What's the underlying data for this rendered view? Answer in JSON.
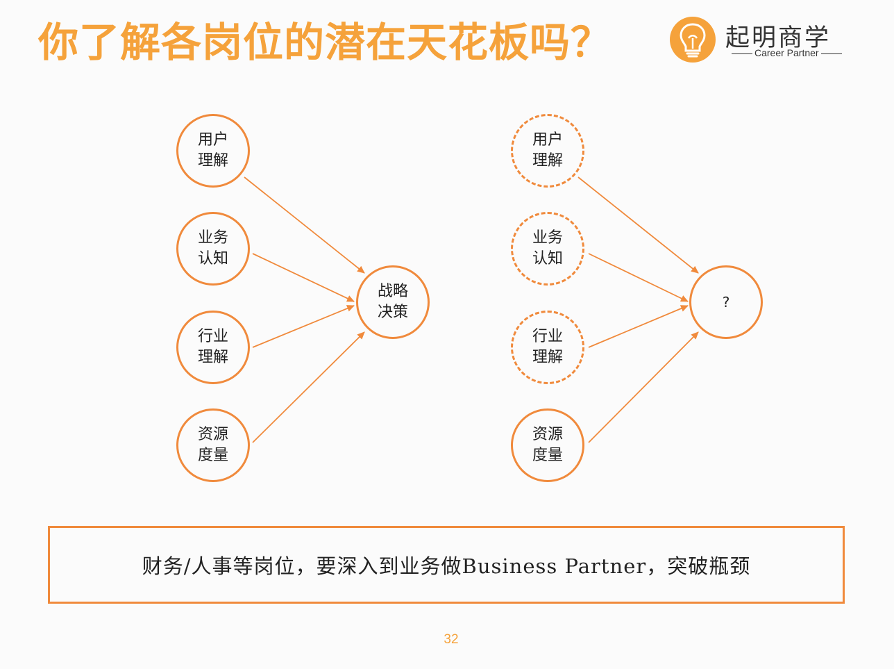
{
  "title": "你了解各岗位的潜在天花板吗？",
  "logo": {
    "name": "起明商学",
    "tagline": "Career Partner"
  },
  "diagram_left": {
    "inputs": [
      {
        "label": "用户理解"
      },
      {
        "label": "业务认知"
      },
      {
        "label": "行业理解"
      },
      {
        "label": "资源度量"
      }
    ],
    "output": {
      "label": "战略决策"
    }
  },
  "diagram_right": {
    "inputs": [
      {
        "label": "用户理解",
        "dashed": true
      },
      {
        "label": "业务认知",
        "dashed": true
      },
      {
        "label": "行业理解",
        "dashed": true
      },
      {
        "label": "资源度量",
        "dashed": false
      }
    ],
    "output": {
      "label": "?"
    }
  },
  "conclusion": "财务/人事等岗位，要深入到业务做Business Partner，突破瓶颈",
  "page_number": "32",
  "colors": {
    "accent": "#f08a3c",
    "title": "#f5a23b",
    "text": "#222222"
  }
}
